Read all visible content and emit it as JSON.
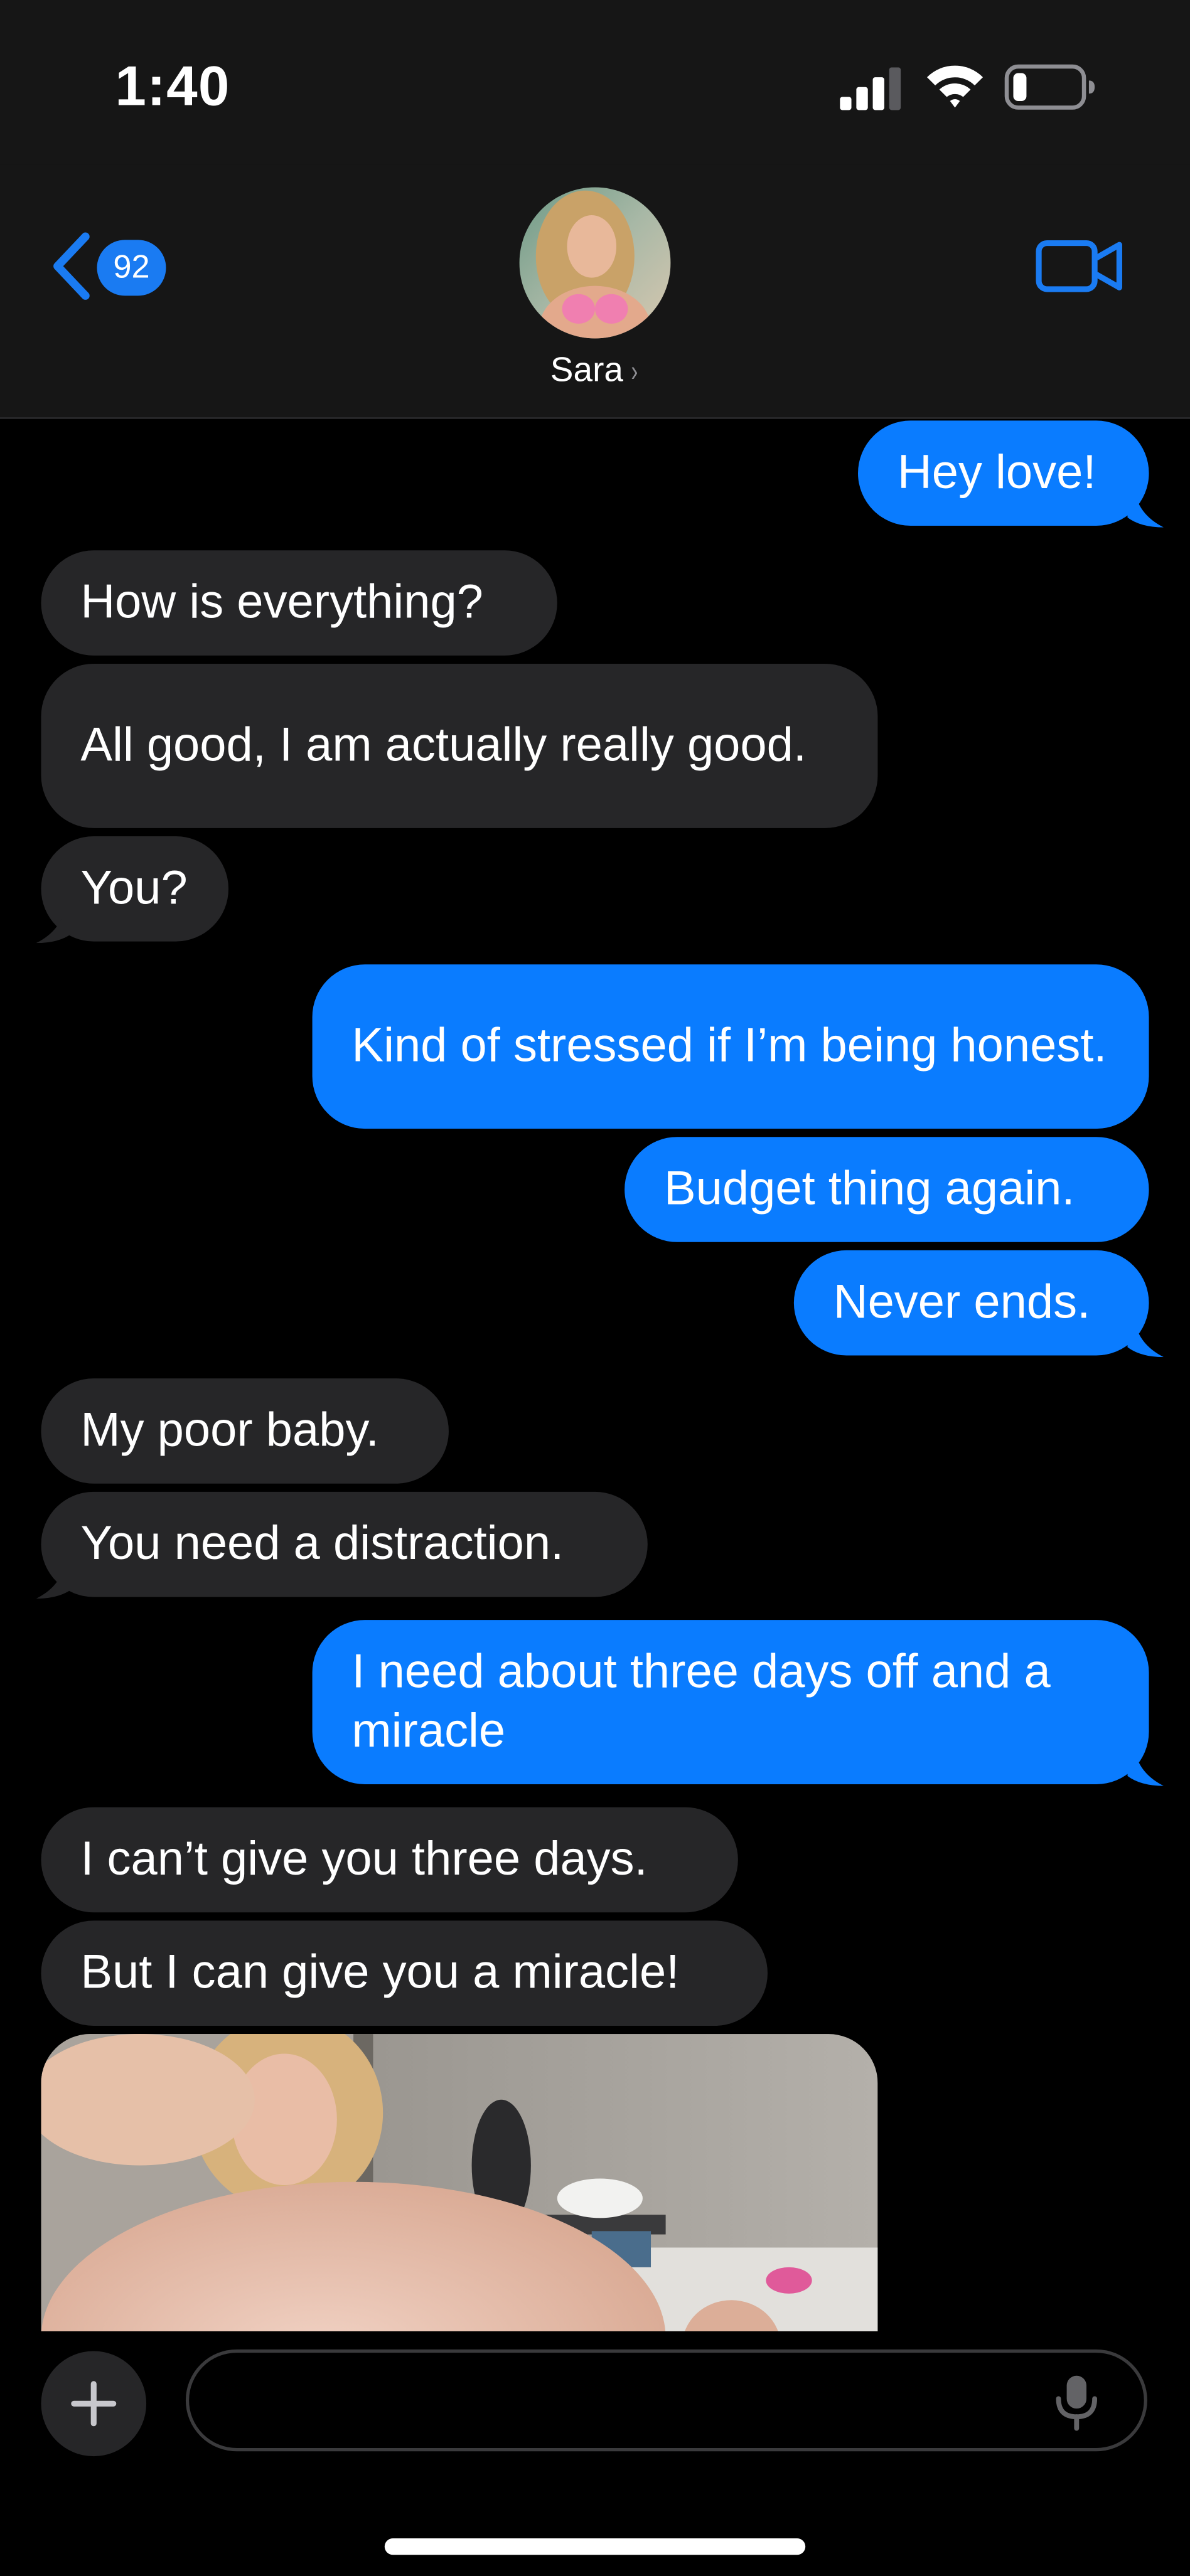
{
  "status_bar": {
    "time": "1:40",
    "signal_icon": "cellular-signal-icon",
    "wifi_icon": "wifi-icon",
    "battery_icon": "battery-low-icon"
  },
  "header": {
    "back_icon": "chevron-left-icon",
    "unread_count": "92",
    "contact_name": "Sara",
    "name_chevron": "›",
    "video_icon": "video-camera-icon"
  },
  "messages": [
    {
      "direction": "outgoing",
      "text": "Hey love!",
      "tail": true
    },
    {
      "direction": "incoming",
      "text": "How is everything?",
      "tail": false
    },
    {
      "direction": "incoming",
      "text": "All good, I am actually really good.",
      "tail": false
    },
    {
      "direction": "incoming",
      "text": "You?",
      "tail": true
    },
    {
      "direction": "outgoing",
      "text": "Kind of stressed if I’m being honest.",
      "tail": false
    },
    {
      "direction": "outgoing",
      "text": "Budget thing again.",
      "tail": false
    },
    {
      "direction": "outgoing",
      "text": "Never ends.",
      "tail": true
    },
    {
      "direction": "incoming",
      "text": "My poor baby.",
      "tail": false
    },
    {
      "direction": "incoming",
      "text": "You need a distraction.",
      "tail": true
    },
    {
      "direction": "outgoing",
      "text": "I need about three days off and a miracle",
      "tail": true
    },
    {
      "direction": "incoming",
      "text": "I can’t give you three days.",
      "tail": false
    },
    {
      "direction": "incoming",
      "text": "But I can give you a miracle!",
      "tail": false
    },
    {
      "direction": "incoming",
      "type": "photo",
      "tail": false
    }
  ],
  "composer": {
    "plus_icon": "plus-icon",
    "input_value": "",
    "input_placeholder": "",
    "mic_icon": "microphone-icon"
  },
  "colors": {
    "outgoing_bubble": "#0a7cff",
    "incoming_bubble": "#262628",
    "accent": "#1a7bf2",
    "header_background": "#161616",
    "background": "#000000"
  }
}
